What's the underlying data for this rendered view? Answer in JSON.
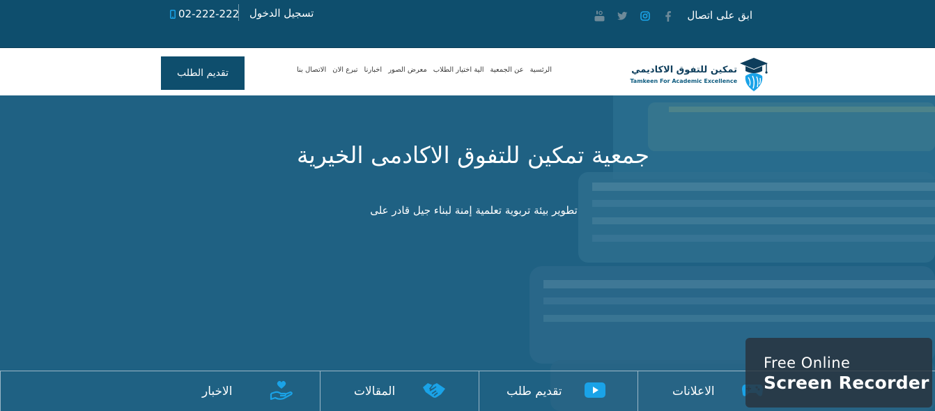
{
  "colors": {
    "brand": "#0e4e6d",
    "hero_overlay": "#1f6183",
    "accent": "#1aa3e8"
  },
  "topbar": {
    "phone": "02-222-222",
    "login": "تسجيل الدخول",
    "contact": "ابق على اتصال",
    "social_icons": [
      "youtube-icon",
      "twitter-icon",
      "instagram-icon",
      "facebook-icon"
    ]
  },
  "navbar": {
    "cta": "تقديم الطلب",
    "menu": [
      "الرئسية",
      "عن الجمعية",
      "الية اختيار الطلاب",
      "معرض الصور",
      "اخبارنا",
      "تبرع الان",
      "الاتصال بنا"
    ],
    "logo": {
      "title_ar": "تمكين للتفوق الاكاديمي",
      "title_en": "Tamkeen For Academic Excellence"
    }
  },
  "hero": {
    "title": "جمعية تمكين للتفوق الاكادمى الخيرية",
    "subtitle": "تطوير بيئة تربوية تعلمية إمنة لبناء جيل قادر على"
  },
  "features": [
    {
      "label": "الاعلانات",
      "icon": "gamepad-icon"
    },
    {
      "label": "تقديم طلب",
      "icon": "video-icon"
    },
    {
      "label": "المقالات",
      "icon": "handshake-icon"
    },
    {
      "label": "الاخبار",
      "icon": "hand-heart-icon"
    }
  ],
  "watermark": {
    "line1": "Free Online",
    "line2": "Screen Recorder"
  }
}
